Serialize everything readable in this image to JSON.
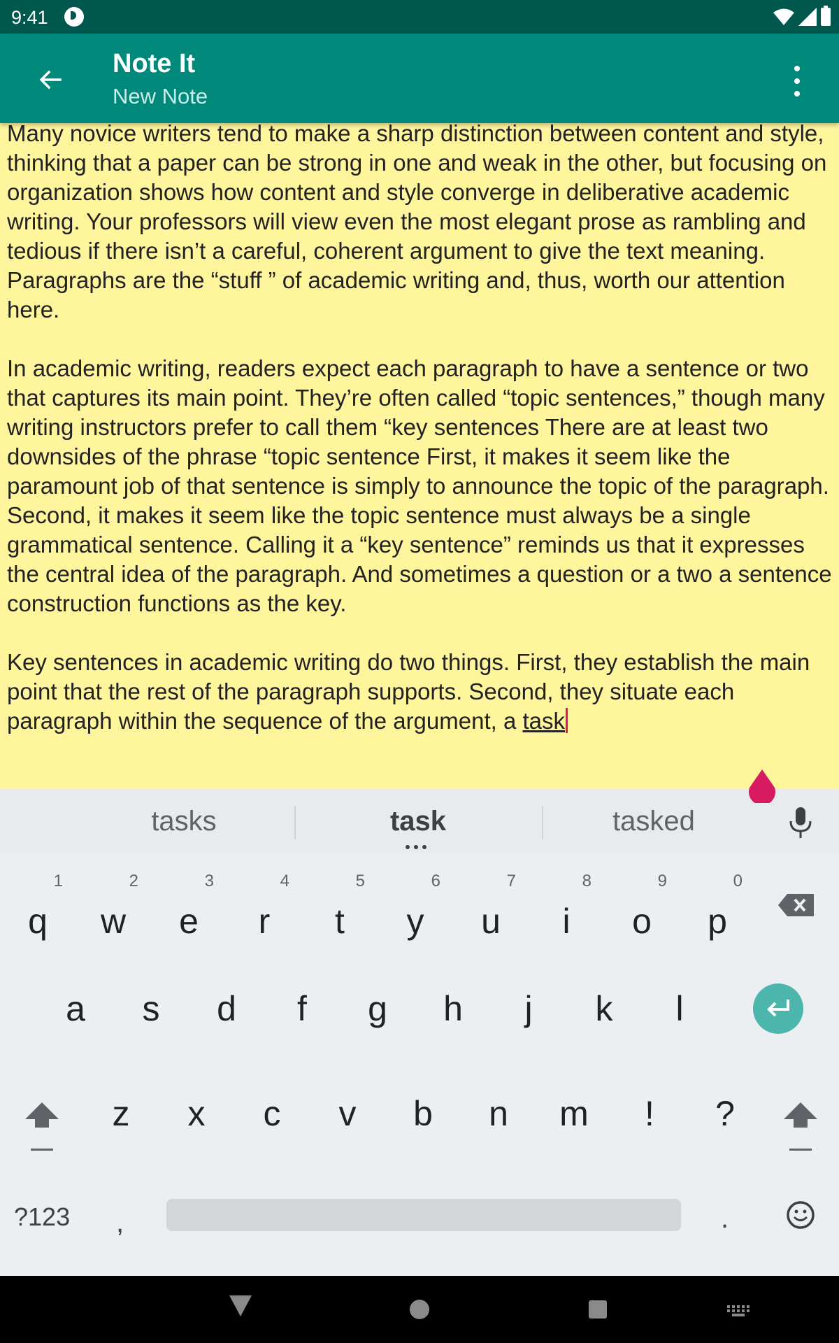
{
  "status_bar": {
    "time": "9:41"
  },
  "app_bar": {
    "title": "Note It",
    "subtitle": "New Note"
  },
  "note": {
    "paragraphs": [
      "Many novice writers tend to make a sharp distinction between content and style, thinking that a paper can be strong in one and weak in the other, but focusing on organization shows how content and style converge in deliberative academic writing. Your professors will view even the most elegant prose as rambling and tedious if there isn’t a careful, coherent argument to give the text meaning. Paragraphs are the “stuff ” of academic writing and, thus, worth our attention here.",
      "In academic writing, readers expect each paragraph to have a sentence or two that captures its main point. They’re often called “topic sentences,” though many writing instructors prefer to call them “key sentences There are at least two downsides of the phrase “topic sentence First, it makes it seem like the paramount job of that sentence is simply to announce the topic of the paragraph. Second, it makes it seem like the topic sentence must always be a single grammatical sentence. Calling it a “key sentence” reminds us that it expresses the central idea of the paragraph. And sometimes a question or a two a sentence construction functions as the key.",
      "Key sentences in academic writing do two things. First, they establish the main point that the rest of the paragraph supports. Second, they situate each paragraph within the sequence of the argument, a "
    ],
    "composing_word": "task"
  },
  "keyboard": {
    "suggestions": [
      "tasks",
      "task",
      "tasked"
    ],
    "row1": [
      {
        "key": "q",
        "hint": "1"
      },
      {
        "key": "w",
        "hint": "2"
      },
      {
        "key": "e",
        "hint": "3"
      },
      {
        "key": "r",
        "hint": "4"
      },
      {
        "key": "t",
        "hint": "5"
      },
      {
        "key": "y",
        "hint": "6"
      },
      {
        "key": "u",
        "hint": "7"
      },
      {
        "key": "i",
        "hint": "8"
      },
      {
        "key": "o",
        "hint": "9"
      },
      {
        "key": "p",
        "hint": "0"
      }
    ],
    "row2": [
      "a",
      "s",
      "d",
      "f",
      "g",
      "h",
      "j",
      "k",
      "l"
    ],
    "row3": [
      "z",
      "x",
      "c",
      "v",
      "b",
      "n",
      "m",
      "!",
      "?"
    ],
    "symbols_label": "?123",
    "comma_label": ",",
    "period_label": ".",
    "enter_color": "#4db6ac"
  },
  "colors": {
    "status_bar": "#00574d",
    "app_bar": "#00897b",
    "note_background": "#fff59d",
    "cursor": "#d81b60"
  }
}
